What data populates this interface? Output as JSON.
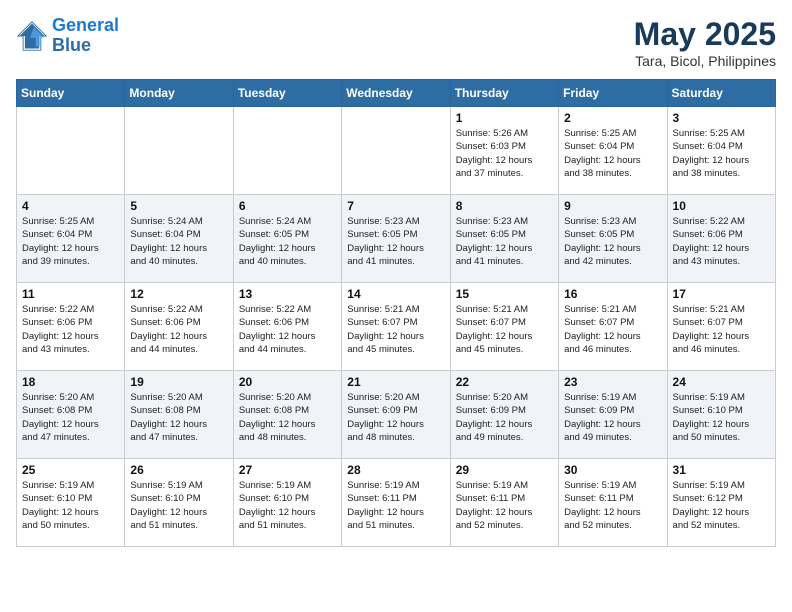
{
  "header": {
    "logo_line1": "General",
    "logo_line2": "Blue",
    "month_year": "May 2025",
    "location": "Tara, Bicol, Philippines"
  },
  "weekdays": [
    "Sunday",
    "Monday",
    "Tuesday",
    "Wednesday",
    "Thursday",
    "Friday",
    "Saturday"
  ],
  "weeks": [
    [
      {
        "day": "",
        "info": ""
      },
      {
        "day": "",
        "info": ""
      },
      {
        "day": "",
        "info": ""
      },
      {
        "day": "",
        "info": ""
      },
      {
        "day": "1",
        "info": "Sunrise: 5:26 AM\nSunset: 6:03 PM\nDaylight: 12 hours\nand 37 minutes."
      },
      {
        "day": "2",
        "info": "Sunrise: 5:25 AM\nSunset: 6:04 PM\nDaylight: 12 hours\nand 38 minutes."
      },
      {
        "day": "3",
        "info": "Sunrise: 5:25 AM\nSunset: 6:04 PM\nDaylight: 12 hours\nand 38 minutes."
      }
    ],
    [
      {
        "day": "4",
        "info": "Sunrise: 5:25 AM\nSunset: 6:04 PM\nDaylight: 12 hours\nand 39 minutes."
      },
      {
        "day": "5",
        "info": "Sunrise: 5:24 AM\nSunset: 6:04 PM\nDaylight: 12 hours\nand 40 minutes."
      },
      {
        "day": "6",
        "info": "Sunrise: 5:24 AM\nSunset: 6:05 PM\nDaylight: 12 hours\nand 40 minutes."
      },
      {
        "day": "7",
        "info": "Sunrise: 5:23 AM\nSunset: 6:05 PM\nDaylight: 12 hours\nand 41 minutes."
      },
      {
        "day": "8",
        "info": "Sunrise: 5:23 AM\nSunset: 6:05 PM\nDaylight: 12 hours\nand 41 minutes."
      },
      {
        "day": "9",
        "info": "Sunrise: 5:23 AM\nSunset: 6:05 PM\nDaylight: 12 hours\nand 42 minutes."
      },
      {
        "day": "10",
        "info": "Sunrise: 5:22 AM\nSunset: 6:06 PM\nDaylight: 12 hours\nand 43 minutes."
      }
    ],
    [
      {
        "day": "11",
        "info": "Sunrise: 5:22 AM\nSunset: 6:06 PM\nDaylight: 12 hours\nand 43 minutes."
      },
      {
        "day": "12",
        "info": "Sunrise: 5:22 AM\nSunset: 6:06 PM\nDaylight: 12 hours\nand 44 minutes."
      },
      {
        "day": "13",
        "info": "Sunrise: 5:22 AM\nSunset: 6:06 PM\nDaylight: 12 hours\nand 44 minutes."
      },
      {
        "day": "14",
        "info": "Sunrise: 5:21 AM\nSunset: 6:07 PM\nDaylight: 12 hours\nand 45 minutes."
      },
      {
        "day": "15",
        "info": "Sunrise: 5:21 AM\nSunset: 6:07 PM\nDaylight: 12 hours\nand 45 minutes."
      },
      {
        "day": "16",
        "info": "Sunrise: 5:21 AM\nSunset: 6:07 PM\nDaylight: 12 hours\nand 46 minutes."
      },
      {
        "day": "17",
        "info": "Sunrise: 5:21 AM\nSunset: 6:07 PM\nDaylight: 12 hours\nand 46 minutes."
      }
    ],
    [
      {
        "day": "18",
        "info": "Sunrise: 5:20 AM\nSunset: 6:08 PM\nDaylight: 12 hours\nand 47 minutes."
      },
      {
        "day": "19",
        "info": "Sunrise: 5:20 AM\nSunset: 6:08 PM\nDaylight: 12 hours\nand 47 minutes."
      },
      {
        "day": "20",
        "info": "Sunrise: 5:20 AM\nSunset: 6:08 PM\nDaylight: 12 hours\nand 48 minutes."
      },
      {
        "day": "21",
        "info": "Sunrise: 5:20 AM\nSunset: 6:09 PM\nDaylight: 12 hours\nand 48 minutes."
      },
      {
        "day": "22",
        "info": "Sunrise: 5:20 AM\nSunset: 6:09 PM\nDaylight: 12 hours\nand 49 minutes."
      },
      {
        "day": "23",
        "info": "Sunrise: 5:19 AM\nSunset: 6:09 PM\nDaylight: 12 hours\nand 49 minutes."
      },
      {
        "day": "24",
        "info": "Sunrise: 5:19 AM\nSunset: 6:10 PM\nDaylight: 12 hours\nand 50 minutes."
      }
    ],
    [
      {
        "day": "25",
        "info": "Sunrise: 5:19 AM\nSunset: 6:10 PM\nDaylight: 12 hours\nand 50 minutes."
      },
      {
        "day": "26",
        "info": "Sunrise: 5:19 AM\nSunset: 6:10 PM\nDaylight: 12 hours\nand 51 minutes."
      },
      {
        "day": "27",
        "info": "Sunrise: 5:19 AM\nSunset: 6:10 PM\nDaylight: 12 hours\nand 51 minutes."
      },
      {
        "day": "28",
        "info": "Sunrise: 5:19 AM\nSunset: 6:11 PM\nDaylight: 12 hours\nand 51 minutes."
      },
      {
        "day": "29",
        "info": "Sunrise: 5:19 AM\nSunset: 6:11 PM\nDaylight: 12 hours\nand 52 minutes."
      },
      {
        "day": "30",
        "info": "Sunrise: 5:19 AM\nSunset: 6:11 PM\nDaylight: 12 hours\nand 52 minutes."
      },
      {
        "day": "31",
        "info": "Sunrise: 5:19 AM\nSunset: 6:12 PM\nDaylight: 12 hours\nand 52 minutes."
      }
    ]
  ]
}
